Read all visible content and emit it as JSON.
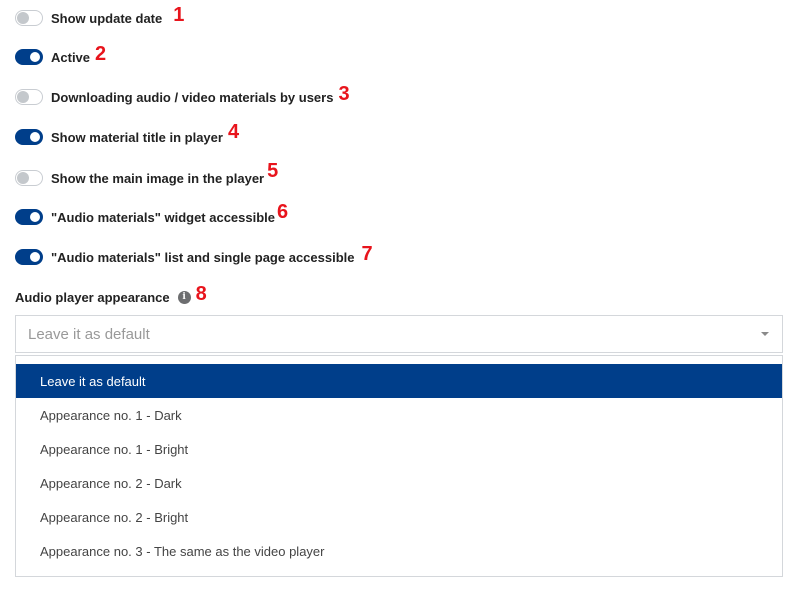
{
  "colors": {
    "accent": "#003e8a",
    "marker": "#e8141c",
    "toggle_off_knob": "#c4c8cc"
  },
  "toggles": [
    {
      "label": "Show update date",
      "on": false,
      "marker": "1"
    },
    {
      "label": "Active",
      "on": true,
      "marker": "2"
    },
    {
      "label": "Downloading audio / video materials by users",
      "on": false,
      "marker": "3"
    },
    {
      "label": "Show material title in player",
      "on": true,
      "marker": "4"
    },
    {
      "label": "Show the main image in the player",
      "on": false,
      "marker": "5"
    },
    {
      "label": "\"Audio materials\" widget accessible",
      "on": true,
      "marker": "6"
    },
    {
      "label": "\"Audio materials\" list and single page accessible",
      "on": true,
      "marker": "7"
    }
  ],
  "appearance": {
    "label": "Audio player appearance",
    "info_icon": "info-icon",
    "info_glyph": "i",
    "marker": "8",
    "selected_value": "Leave it as default",
    "options": [
      {
        "label": "Leave it as default",
        "selected": true
      },
      {
        "label": "Appearance no. 1 - Dark",
        "selected": false
      },
      {
        "label": "Appearance no. 1 - Bright",
        "selected": false
      },
      {
        "label": "Appearance no. 2 - Dark",
        "selected": false
      },
      {
        "label": "Appearance no. 2 - Bright",
        "selected": false
      },
      {
        "label": "Appearance no. 3 - The same as the video player",
        "selected": false
      }
    ]
  }
}
